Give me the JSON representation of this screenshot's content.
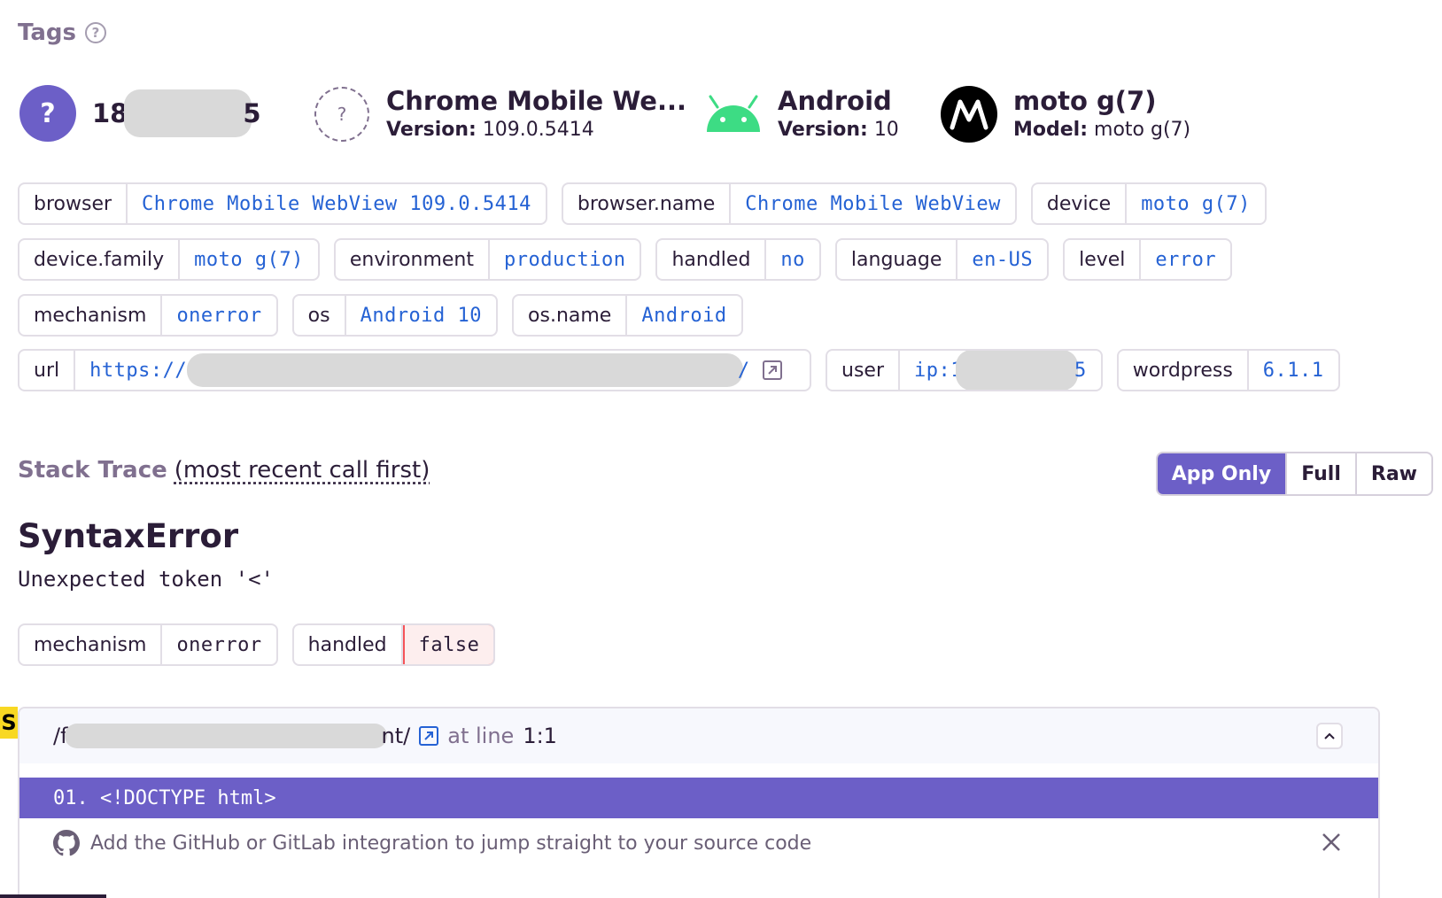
{
  "tags_section": {
    "title": "Tags",
    "help_icon": "question-circle-icon"
  },
  "context": {
    "user": {
      "icon": "question-mark",
      "title_start": "18",
      "title_end": "5"
    },
    "browser": {
      "title": "Chrome Mobile We...",
      "sub_label": "Version:",
      "sub_value": "109.0.5414"
    },
    "os": {
      "title": "Android",
      "sub_label": "Version:",
      "sub_value": "10"
    },
    "device": {
      "title": "moto g(7)",
      "sub_label": "Model:",
      "sub_value": "moto g(7)"
    }
  },
  "tags": {
    "browser": {
      "key": "browser",
      "value": "Chrome Mobile WebView 109.0.5414"
    },
    "browser_name": {
      "key": "browser.name",
      "value": "Chrome Mobile WebView"
    },
    "device": {
      "key": "device",
      "value": "moto g(7)"
    },
    "device_family": {
      "key": "device.family",
      "value": "moto g(7)"
    },
    "environment": {
      "key": "environment",
      "value": "production"
    },
    "handled": {
      "key": "handled",
      "value": "no"
    },
    "language": {
      "key": "language",
      "value": "en-US"
    },
    "level": {
      "key": "level",
      "value": "error"
    },
    "mechanism": {
      "key": "mechanism",
      "value": "onerror"
    },
    "os": {
      "key": "os",
      "value": "Android 10"
    },
    "os_name": {
      "key": "os.name",
      "value": "Android"
    },
    "url": {
      "key": "url",
      "value_start": "https://c",
      "value_end": "/"
    },
    "user": {
      "key": "user",
      "value_start": "ip:1",
      "value_end": "5"
    },
    "wordpress": {
      "key": "wordpress",
      "value": "6.1.1"
    }
  },
  "stack_trace": {
    "title": "Stack Trace",
    "subtitle": "(most recent call first)",
    "view_options": [
      "App Only",
      "Full",
      "Raw"
    ],
    "active_view": "App Only",
    "exception_type": "SyntaxError",
    "exception_message": "Unexpected token '<'",
    "mechanism": {
      "key": "mechanism",
      "value": "onerror"
    },
    "handled": {
      "key": "handled",
      "value": "false"
    },
    "frame": {
      "badge": "S",
      "path_start": "/f",
      "path_end": "nt/",
      "at_line_label": "at line",
      "line_col": "1:1",
      "code_line": "01. <!DOCTYPE html>"
    },
    "integration_prompt": "Add the GitHub or GitLab integration to jump straight to your source code"
  },
  "colors": {
    "accent": "#6c5fc7",
    "link": "#2562d4",
    "error_border": "#f55459",
    "heading_muted": "#80708f"
  }
}
